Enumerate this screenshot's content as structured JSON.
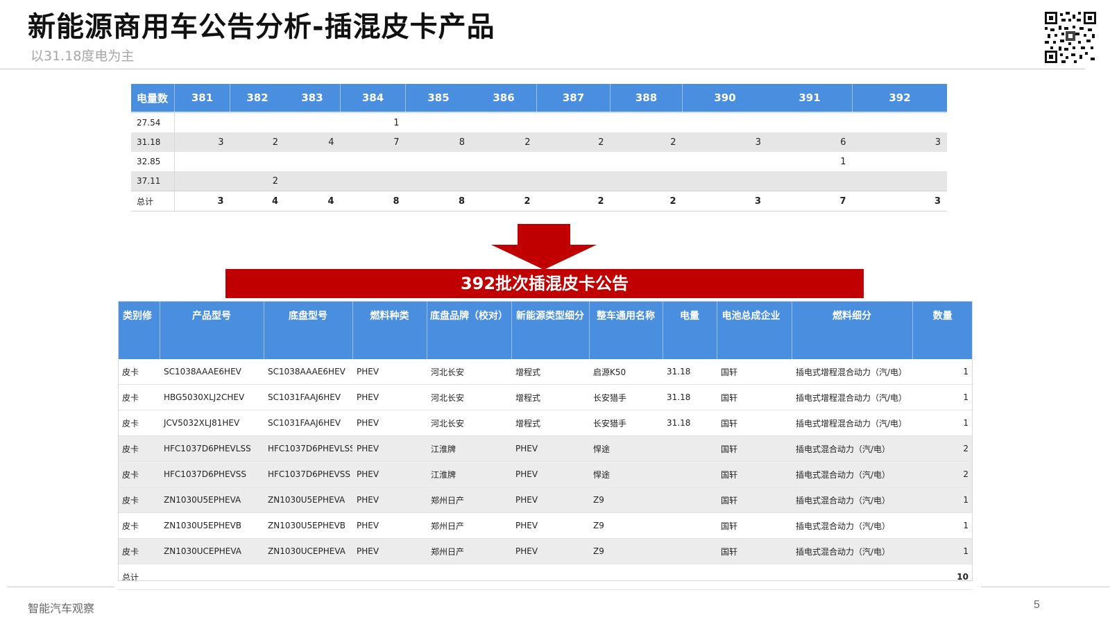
{
  "header": {
    "title": "新能源商用车公告分析-插混皮卡产品",
    "subtitle": "以31.18度电为主"
  },
  "summary_table": {
    "corner": "电量数",
    "columns": [
      "381",
      "382",
      "383",
      "384",
      "385",
      "386",
      "387",
      "388",
      "390",
      "391",
      "392"
    ],
    "rows": [
      {
        "label": "27.54",
        "cells": [
          "",
          "",
          "",
          "1",
          "",
          "",
          "",
          "",
          "",
          "",
          ""
        ]
      },
      {
        "label": "31.18",
        "cells": [
          "3",
          "2",
          "4",
          "7",
          "8",
          "2",
          "2",
          "2",
          "3",
          "6",
          "3"
        ]
      },
      {
        "label": "32.85",
        "cells": [
          "",
          "",
          "",
          "",
          "",
          "",
          "",
          "",
          "",
          "1",
          ""
        ]
      },
      {
        "label": "37.11",
        "cells": [
          "",
          "2",
          "",
          "",
          "",
          "",
          "",
          "",
          "",
          "",
          ""
        ]
      },
      {
        "label": "总计",
        "cells": [
          "3",
          "4",
          "4",
          "8",
          "8",
          "2",
          "2",
          "2",
          "3",
          "7",
          "3"
        ]
      }
    ]
  },
  "banner": {
    "text": "392批次插混皮卡公告",
    "color": "#c00000"
  },
  "detail_table": {
    "headers": [
      "类别修",
      "产品型号",
      "底盘型号",
      "燃料种类",
      "底盘品牌（校对）",
      "新能源类型细分",
      "整车通用名称",
      "电量",
      "电池总成企业",
      "燃料细分",
      "数量"
    ],
    "rows": [
      [
        "皮卡",
        "SC1038AAAE6HEV",
        "SC1038AAAE6HEV",
        "PHEV",
        "河北长安",
        "增程式",
        "启源K50",
        "31.18",
        "国轩",
        "插电式增程混合动力（汽/电）",
        "1"
      ],
      [
        "皮卡",
        "HBG5030XLJ2CHEV",
        "SC1031FAAJ6HEV",
        "PHEV",
        "河北长安",
        "增程式",
        "长安猎手",
        "31.18",
        "国轩",
        "插电式增程混合动力（汽/电）",
        "1"
      ],
      [
        "皮卡",
        "JCV5032XLJ81HEV",
        "SC1031FAAJ6HEV",
        "PHEV",
        "河北长安",
        "增程式",
        "长安猎手",
        "31.18",
        "国轩",
        "插电式增程混合动力（汽/电）",
        "1"
      ],
      [
        "皮卡",
        "HFC1037D6PHEVLSS",
        "HFC1037D6PHEVLSS",
        "PHEV",
        "江淮牌",
        "PHEV",
        "悍途",
        "",
        "国轩",
        "插电式混合动力（汽/电）",
        "2"
      ],
      [
        "皮卡",
        "HFC1037D6PHEVSS",
        "HFC1037D6PHEVSS",
        "PHEV",
        "江淮牌",
        "PHEV",
        "悍途",
        "",
        "国轩",
        "插电式混合动力（汽/电）",
        "2"
      ],
      [
        "皮卡",
        "ZN1030U5EPHEVA",
        "ZN1030U5EPHEVA",
        "PHEV",
        "郑州日产",
        "PHEV",
        "Z9",
        "",
        "国轩",
        "插电式混合动力（汽/电）",
        "1"
      ],
      [
        "皮卡",
        "ZN1030U5EPHEVB",
        "ZN1030U5EPHEVB",
        "PHEV",
        "郑州日产",
        "PHEV",
        "Z9",
        "",
        "国轩",
        "插电式混合动力（汽/电）",
        "1"
      ],
      [
        "皮卡",
        "ZN1030UCEPHEVA",
        "ZN1030UCEPHEVA",
        "PHEV",
        "郑州日产",
        "PHEV",
        "Z9",
        "",
        "国轩",
        "插电式混合动力（汽/电）",
        "1"
      ]
    ],
    "total_label": "总计",
    "total_value": "10"
  },
  "footer": {
    "source": "智能汽车观察",
    "page": "5"
  },
  "colors": {
    "header_blue": "#4a8ee0",
    "banner_red": "#c00000"
  }
}
